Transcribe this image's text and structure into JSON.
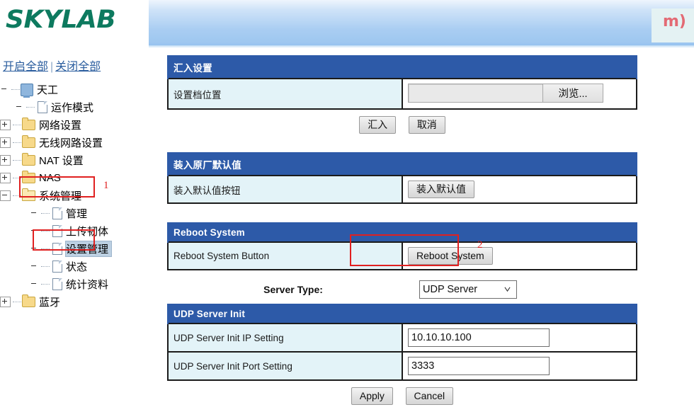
{
  "banner": {
    "logo_text": "SKYLAB",
    "badge_text": "m)"
  },
  "sidebar": {
    "expand_all": "开启全部",
    "separator": "|",
    "collapse_all": "关闭全部",
    "tree": [
      {
        "label": "天工",
        "icon": "computer-icon",
        "level": 0,
        "expander": "none"
      },
      {
        "label": "运作模式",
        "icon": "page-icon",
        "level": 1,
        "expander": "none"
      },
      {
        "label": "网络设置",
        "icon": "folder-icon",
        "level": 0,
        "expander": "plus"
      },
      {
        "label": "无线网路设置",
        "icon": "folder-icon",
        "level": 0,
        "expander": "plus"
      },
      {
        "label": "NAT 设置",
        "icon": "folder-icon",
        "level": 0,
        "expander": "plus"
      },
      {
        "label": "NAS",
        "icon": "folder-icon",
        "level": 0,
        "expander": "plus"
      },
      {
        "label": "系统管理",
        "icon": "folder-open-icon",
        "level": 0,
        "expander": "minus"
      },
      {
        "label": "管理",
        "icon": "page-icon",
        "level": 2,
        "expander": "none"
      },
      {
        "label": "上传韧体",
        "icon": "page-icon",
        "level": 2,
        "expander": "none"
      },
      {
        "label": "设置管理",
        "icon": "page-icon",
        "level": 2,
        "expander": "none",
        "selected": true
      },
      {
        "label": "状态",
        "icon": "page-icon",
        "level": 2,
        "expander": "none"
      },
      {
        "label": "统计资料",
        "icon": "page-icon",
        "level": 2,
        "expander": "none"
      },
      {
        "label": "蓝牙",
        "icon": "folder-icon",
        "level": 0,
        "expander": "plus"
      }
    ]
  },
  "annotations": {
    "marker_1": "1",
    "marker_2": "2",
    "color": "#e02020"
  },
  "import_section": {
    "header": "汇入设置",
    "row_label": "设置档位置",
    "file_value": "",
    "browse_label": "浏览...",
    "submit_label": "汇入",
    "cancel_label": "取消"
  },
  "defaults_section": {
    "header": "装入原厂默认值",
    "row_label": "装入默认值按钮",
    "button_label": "装入默认值"
  },
  "reboot_section": {
    "header": "Reboot System",
    "row_label": "Reboot System Button",
    "button_label": "Reboot System"
  },
  "server_type": {
    "label": "Server Type:",
    "selected": "UDP Server",
    "options": [
      "UDP Server"
    ]
  },
  "udp_section": {
    "header": "UDP Server Init",
    "rows": [
      {
        "label": "UDP Server Init IP Setting",
        "value": "10.10.10.100"
      },
      {
        "label": "UDP Server Init Port Setting",
        "value": "3333"
      }
    ],
    "apply_label": "Apply",
    "cancel_label": "Cancel"
  },
  "colors": {
    "section_header_blue": "#2d5aa8",
    "label_cell_blue": "#e3f3f8",
    "logo_green": "#0d7a5f",
    "link_blue": "#2a5d9e"
  }
}
